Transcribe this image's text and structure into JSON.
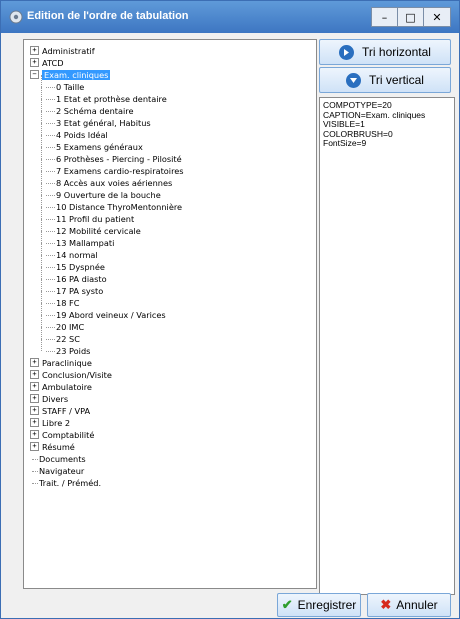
{
  "window": {
    "title": "Edition de l'ordre de tabulation",
    "minimize_glyph": "–",
    "maximize_glyph": "□",
    "close_glyph": "✕"
  },
  "tree": {
    "roots_before": [
      "Administratif",
      "ATCD"
    ],
    "selected": "Exam. cliniques",
    "children": [
      "0 Taille",
      "1 Etat et prothèse dentaire",
      "2 Schéma dentaire",
      "3 Etat général, Habitus",
      "4 Poids Idéal",
      "5 Examens généraux",
      "6 Prothèses - Piercing - Pilosité",
      "7 Examens cardio-respiratoires",
      "8 Accès aux voies aériennes",
      "9 Ouverture de la bouche",
      "10 Distance ThyroMentonnière",
      "11 Profil du patient",
      "12 Mobilité cervicale",
      "13 Mallampati",
      "14 normal",
      "15 Dyspnée",
      "16 PA diasto",
      "17 PA systo",
      "18 FC",
      "19 Abord veineux / Varices",
      "20 IMC",
      "22 SC",
      "23 Poids"
    ],
    "roots_after": [
      "Paraclinique",
      "Conclusion/Visite",
      "Ambulatoire",
      "Divers",
      "STAFF  / VPA",
      "Libre 2",
      "Comptabilité",
      "Résumé"
    ],
    "leaf_roots": [
      "Documents",
      "Navigateur",
      "Trait. / Préméd."
    ]
  },
  "buttons": {
    "tri_horizontal": "Tri horizontal",
    "tri_vertical": "Tri vertical",
    "enregistrer": "Enregistrer",
    "annuler": "Annuler"
  },
  "properties": [
    "COMPOTYPE=20",
    "CAPTION=Exam. cliniques",
    "VISIBLE=1",
    "COLORBRUSH=0",
    "FontSize=9"
  ],
  "colors": {
    "accent": "#3399ff",
    "save_check": "#2e9e2e",
    "cancel_x": "#d62a1e",
    "title_bar": "#4a84cc"
  }
}
